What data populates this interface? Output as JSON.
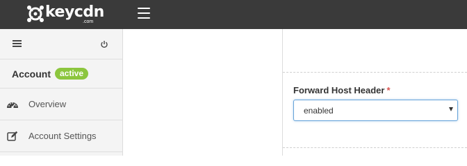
{
  "header": {
    "logo_text": "keycdn",
    "logo_sub": ".com",
    "menu_icon": "hamburger-icon"
  },
  "sidebar": {
    "menu_icon": "hamburger-icon",
    "power_icon": "power-icon",
    "account_title": "Account",
    "account_badge": "active",
    "items": [
      {
        "label": "Overview",
        "icon": "dashboard-icon"
      },
      {
        "label": "Account Settings",
        "icon": "edit-icon"
      }
    ]
  },
  "form": {
    "field_label": "Forward Host Header",
    "required_mark": "*",
    "select_value": "enabled"
  },
  "colors": {
    "topbar": "#3a3a3a",
    "badge": "#8cc63e",
    "required": "#d9534f",
    "focus_border": "#66a3d9"
  }
}
